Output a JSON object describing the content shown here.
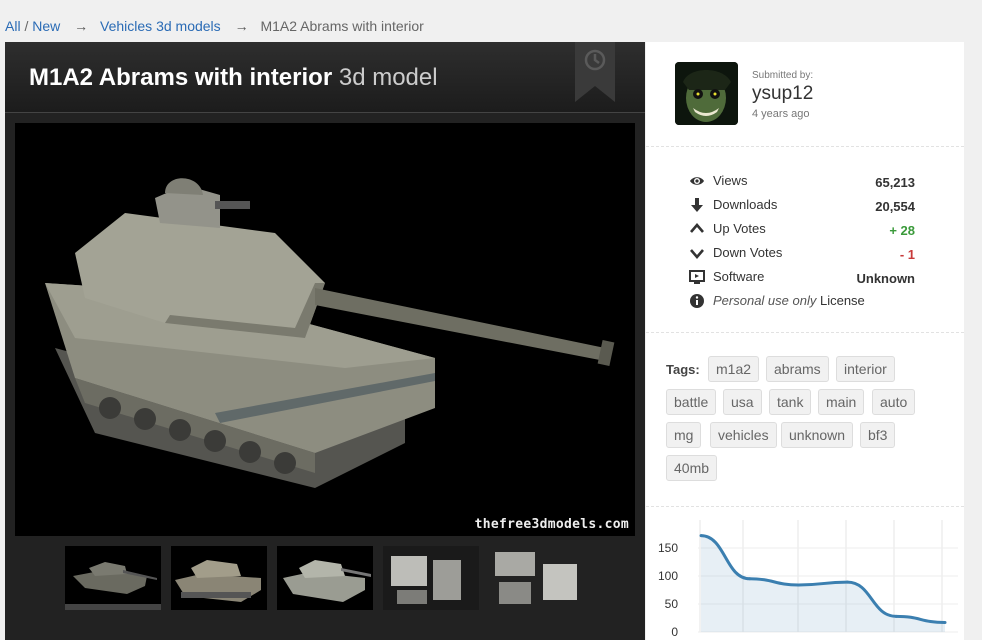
{
  "breadcrumb": {
    "all": "All",
    "separator": "/",
    "new": "New",
    "arrow": "→",
    "category": "Vehicles 3d models",
    "current": "M1A2 Abrams with interior"
  },
  "model": {
    "title": "M1A2 Abrams with interior",
    "title_suffix": "3d model",
    "watermark": "thefree3dmodels.com",
    "thumbnail_count": 5
  },
  "submitter": {
    "submitted_by_label": "Submitted by:",
    "username": "ysup12",
    "time_ago": "4 years ago"
  },
  "stats": {
    "views_label": "Views",
    "views": "65,213",
    "downloads_label": "Downloads",
    "downloads": "20,554",
    "upvotes_label": "Up Votes",
    "upvotes": "+ 28",
    "downvotes_label": "Down Votes",
    "downvotes": "- 1",
    "software_label": "Software",
    "software": "Unknown",
    "license_italic": "Personal use only",
    "license_word": "License"
  },
  "tags": {
    "label": "Tags:",
    "items": [
      "m1a2",
      "abrams",
      "interior",
      "battle",
      "usa",
      "tank",
      "main",
      "auto",
      "mg",
      "vehicles",
      "unknown",
      "bf3",
      "40mb"
    ]
  },
  "icons": {
    "views": "eye-icon",
    "downloads": "arrow-down-icon",
    "upvotes": "chevron-up-icon",
    "downvotes": "chevron-down-icon",
    "software": "monitor-icon",
    "license": "info-icon",
    "bookmark": "clock-bookmark-icon"
  },
  "colors": {
    "link": "#2a6bb5",
    "positive": "#3a9a3a",
    "negative": "#c83a3a",
    "chart_line": "#3b7fb0"
  },
  "chart_data": {
    "type": "area",
    "y_ticks": [
      "150",
      "100",
      "50",
      "0"
    ],
    "ylim": [
      0,
      150
    ],
    "values": [
      172,
      95,
      84,
      89,
      28,
      17
    ],
    "grid": true
  }
}
